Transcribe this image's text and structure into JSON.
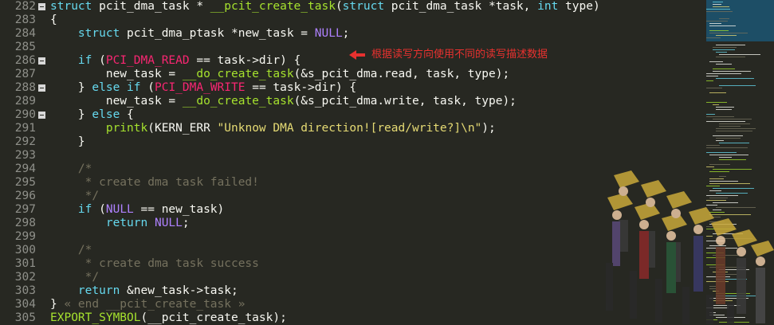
{
  "code_lines": [
    {
      "n": "282",
      "fold": true,
      "text": "struct pcit_dma_task * __pcit_create_task(struct pcit_dma_task *task, int type)"
    },
    {
      "n": "283",
      "fold": false,
      "text": "{"
    },
    {
      "n": "284",
      "fold": false,
      "text": "    struct pcit_dma_ptask *new_task = NULL;"
    },
    {
      "n": "285",
      "fold": false,
      "text": ""
    },
    {
      "n": "286",
      "fold": true,
      "text": "    if (PCI_DMA_READ == task->dir) {"
    },
    {
      "n": "287",
      "fold": false,
      "text": "        new_task = __do_create_task(&s_pcit_dma.read, task, type);"
    },
    {
      "n": "288",
      "fold": true,
      "text": "    } else if (PCI_DMA_WRITE == task->dir) {"
    },
    {
      "n": "289",
      "fold": false,
      "text": "        new_task = __do_create_task(&s_pcit_dma.write, task, type);"
    },
    {
      "n": "290",
      "fold": true,
      "text": "    } else {"
    },
    {
      "n": "291",
      "fold": false,
      "text": "        printk(KERN_ERR \"Unknow DMA direction![read/write?]\\n\");"
    },
    {
      "n": "292",
      "fold": false,
      "text": "    }"
    },
    {
      "n": "293",
      "fold": false,
      "text": ""
    },
    {
      "n": "294",
      "fold": false,
      "text": "    /*"
    },
    {
      "n": "295",
      "fold": false,
      "text": "     * create dma task failed!"
    },
    {
      "n": "296",
      "fold": false,
      "text": "     */"
    },
    {
      "n": "297",
      "fold": false,
      "text": "    if (NULL == new_task)"
    },
    {
      "n": "298",
      "fold": false,
      "text": "        return NULL;"
    },
    {
      "n": "299",
      "fold": false,
      "text": ""
    },
    {
      "n": "300",
      "fold": false,
      "text": "    /*"
    },
    {
      "n": "301",
      "fold": false,
      "text": "     * create dma task success"
    },
    {
      "n": "302",
      "fold": false,
      "text": "     */"
    },
    {
      "n": "303",
      "fold": false,
      "text": "    return &new_task->task;"
    },
    {
      "n": "304",
      "fold": false,
      "text": "} « end __pcit_create_task »"
    },
    {
      "n": "305",
      "fold": false,
      "text": "EXPORT_SYMBOL(__pcit_create_task);"
    }
  ],
  "annotation": {
    "text": "根据读写方向使用不同的读写描述数据",
    "color": "#e8312f"
  },
  "theme": {
    "background": "#272822",
    "line_number_color": "#8f908a",
    "keyword_color": "#66d9ef",
    "function_color": "#a6e22e",
    "string_color": "#e6db74",
    "constant_color": "#ae81ff",
    "macro_color": "#f92672",
    "comment_color": "#75715e",
    "minimap_viewport_color": "#1d4e66"
  },
  "icons": {
    "fold_marker": "minus-box-icon",
    "annotation_arrow": "arrow-left-icon",
    "watermark": "crowd-watermark-image"
  }
}
